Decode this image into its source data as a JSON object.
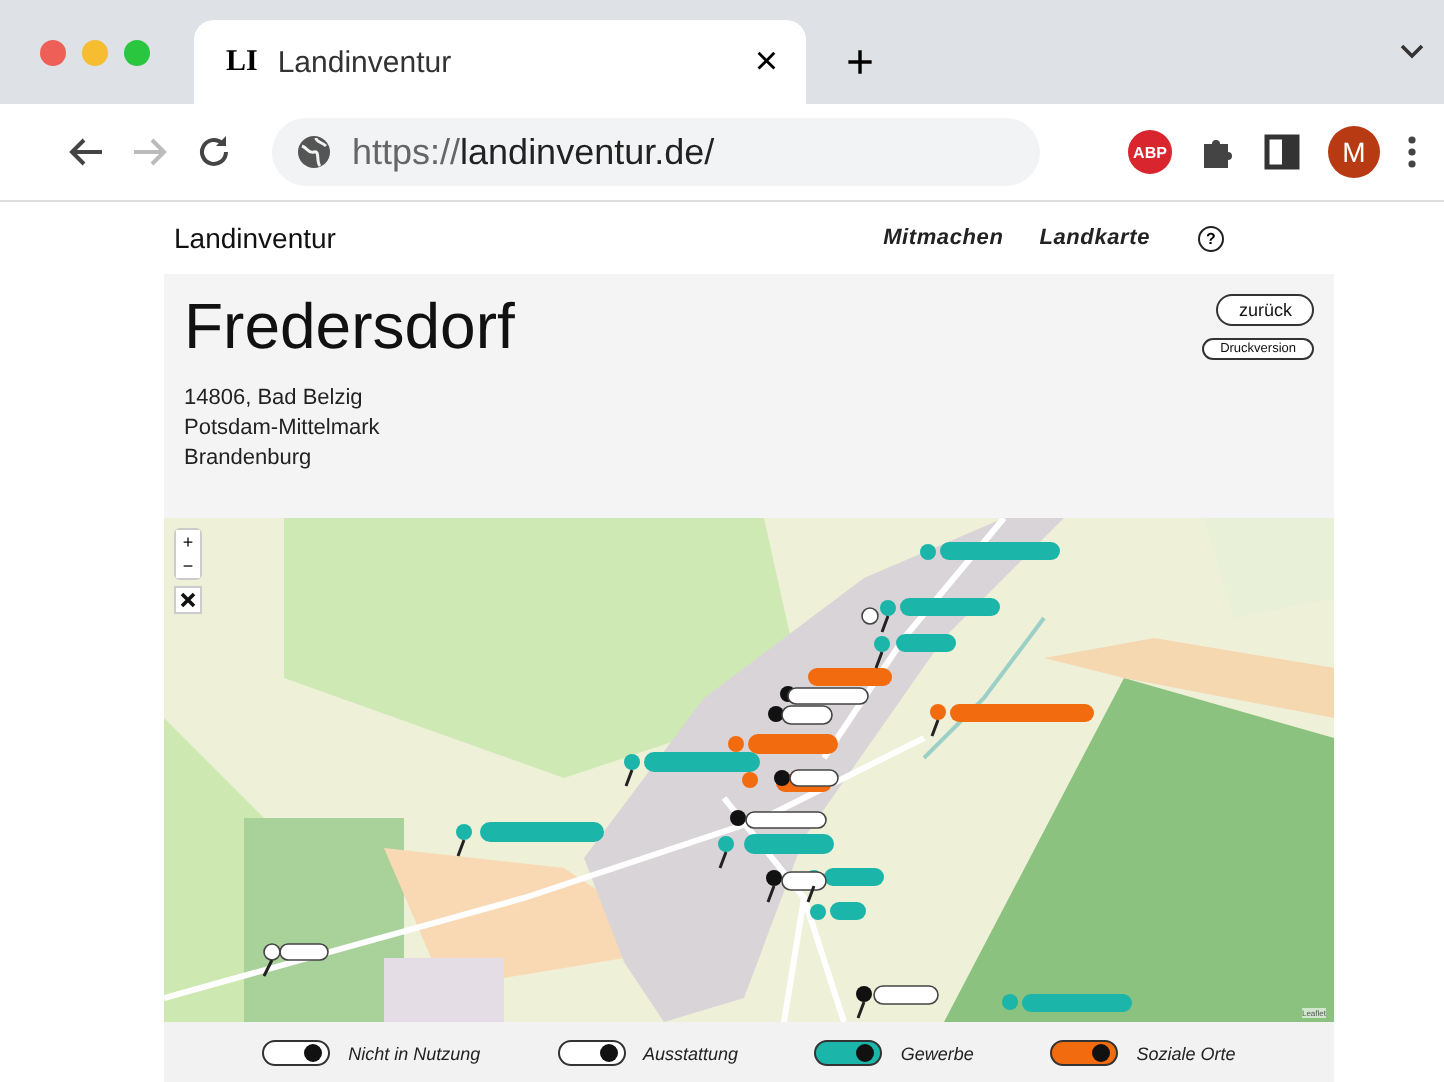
{
  "browser": {
    "tab": {
      "icon_text": "LI",
      "title": "Landinventur",
      "close": "×"
    },
    "new_tab": "+",
    "url_prefix": "https://",
    "url_host": "landinventur.de/",
    "avatar": "M",
    "abp": "ABP"
  },
  "site": {
    "logo": "Landinventur",
    "nav": [
      {
        "label": "Mitmachen"
      },
      {
        "label": "Landkarte"
      }
    ],
    "help": "?"
  },
  "place": {
    "title": "Fredersdorf",
    "address": [
      "14806, Bad Belzig",
      "Potsdam-Mittelmark",
      "Brandenburg"
    ],
    "buttons": [
      {
        "label": "zurück",
        "kind": "large"
      },
      {
        "label": "Druckversion",
        "kind": "small"
      }
    ]
  },
  "map": {
    "zoom_in": "+",
    "zoom_out": "−",
    "attribution": "Leaflet"
  },
  "legend": [
    {
      "label": "Nicht in Nutzung",
      "on": true,
      "color": "#ffffff"
    },
    {
      "label": "Ausstattung",
      "on": true,
      "color": "#ffffff"
    },
    {
      "label": "Gewerbe",
      "on": true,
      "color": "#1bb5a9"
    },
    {
      "label": "Soziale Orte",
      "on": true,
      "color": "#f26b0f"
    }
  ]
}
